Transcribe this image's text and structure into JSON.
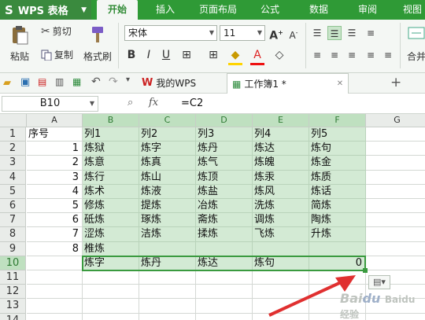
{
  "app": {
    "name": "WPS 表格"
  },
  "menu_tabs": [
    "开始",
    "插入",
    "页面布局",
    "公式",
    "数据",
    "审阅",
    "视图"
  ],
  "ribbon": {
    "paste": "粘贴",
    "cut": "剪切",
    "copy": "复制",
    "format_painter": "格式刷",
    "font_name": "宋体",
    "font_size": "11",
    "bold": "B",
    "italic": "I",
    "underline": "U",
    "font_color_glyph": "A",
    "grow_font": "A",
    "shrink_font": "A",
    "merge_center": "合并"
  },
  "doc_tabs": [
    {
      "label": "我的WPS"
    },
    {
      "label": "工作簿1 *"
    }
  ],
  "formula_bar": {
    "name_box": "B10",
    "fx": "fx",
    "formula": "=C2"
  },
  "columns": [
    "A",
    "B",
    "C",
    "D",
    "E",
    "F",
    "G"
  ],
  "rows": [
    {
      "n": "1",
      "cells": [
        "序号",
        "列1",
        "列2",
        "列3",
        "列4",
        "列5",
        ""
      ]
    },
    {
      "n": "2",
      "cells": [
        "1",
        "炼狱",
        "炼字",
        "炼丹",
        "炼达",
        "炼句",
        ""
      ]
    },
    {
      "n": "3",
      "cells": [
        "2",
        "炼意",
        "炼真",
        "炼气",
        "炼魄",
        "炼金",
        ""
      ]
    },
    {
      "n": "4",
      "cells": [
        "3",
        "炼行",
        "炼山",
        "炼顶",
        "炼汞",
        "炼质",
        ""
      ]
    },
    {
      "n": "5",
      "cells": [
        "4",
        "炼术",
        "炼液",
        "炼盐",
        "炼风",
        "炼话",
        ""
      ]
    },
    {
      "n": "6",
      "cells": [
        "5",
        "修炼",
        "提炼",
        "冶炼",
        "洗炼",
        "简炼",
        ""
      ]
    },
    {
      "n": "7",
      "cells": [
        "6",
        "砥炼",
        "琢炼",
        "斋炼",
        "调炼",
        "陶炼",
        ""
      ]
    },
    {
      "n": "8",
      "cells": [
        "7",
        "涩炼",
        "洁炼",
        "揉炼",
        "飞炼",
        "升炼",
        ""
      ]
    },
    {
      "n": "9",
      "cells": [
        "8",
        "椎炼",
        "",
        "",
        "",
        "",
        ""
      ]
    },
    {
      "n": "10",
      "cells": [
        "",
        "炼字",
        "炼丹",
        "炼达",
        "炼句",
        "0",
        ""
      ]
    },
    {
      "n": "11",
      "cells": [
        "",
        "",
        "",
        "",
        "",
        "",
        ""
      ]
    },
    {
      "n": "12",
      "cells": [
        "",
        "",
        "",
        "",
        "",
        "",
        ""
      ]
    },
    {
      "n": "13",
      "cells": [
        "",
        "",
        "",
        "",
        "",
        "",
        ""
      ]
    },
    {
      "n": "14",
      "cells": [
        "",
        "",
        "",
        "",
        "",
        "",
        ""
      ]
    }
  ],
  "colors": {
    "brand_green": "#2f9a36",
    "selection": "#d3ead4",
    "arrow": "#e03030"
  },
  "watermark": "Baidu 经验"
}
